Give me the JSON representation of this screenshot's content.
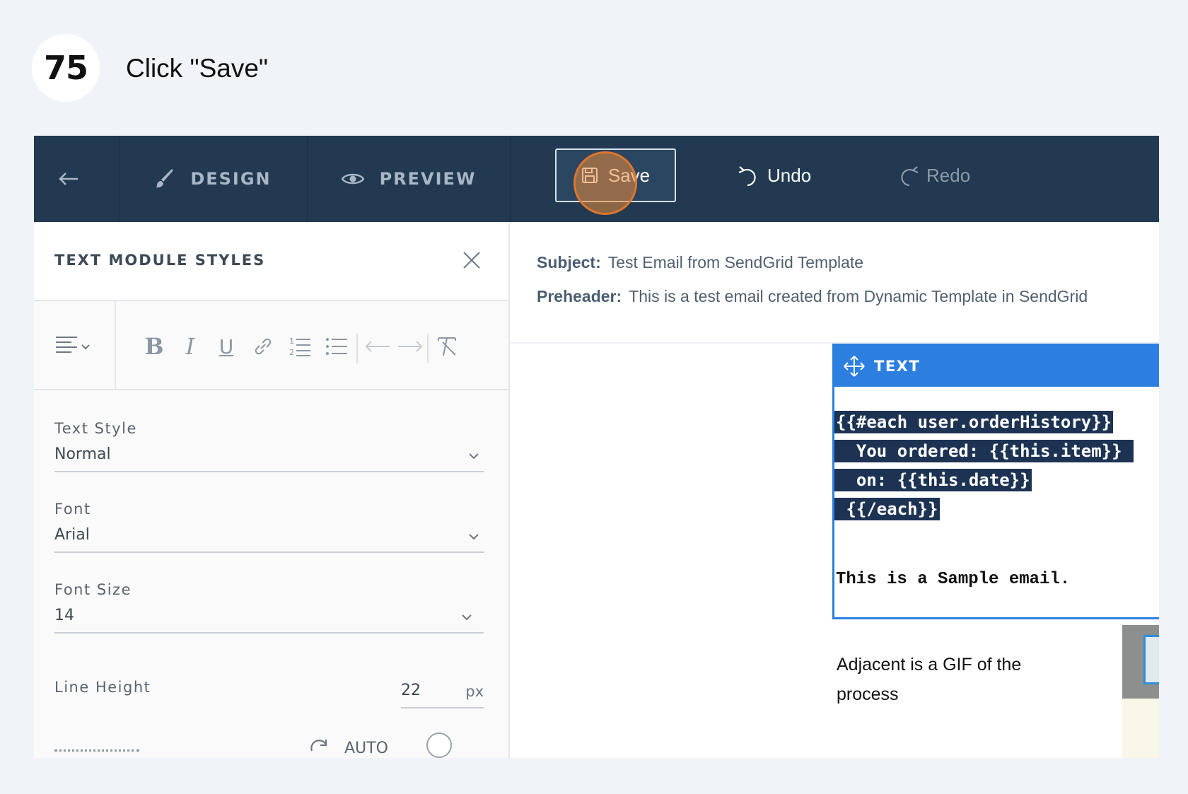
{
  "step": {
    "number": "75",
    "instruction": "Click \"Save\""
  },
  "topbar": {
    "back_icon": "arrow-left-icon",
    "design_label": "DESIGN",
    "preview_label": "PREVIEW",
    "save_label": "Save",
    "undo_label": "Undo",
    "redo_label": "Redo",
    "colors": {
      "bar": "#213a51",
      "highlight_ring": "#e88a3a"
    }
  },
  "left_panel": {
    "title": "TEXT MODULE STYLES",
    "toolbar_icons": [
      "align-left-icon",
      "bold-icon",
      "italic-icon",
      "underline-icon",
      "link-icon",
      "ordered-list-icon",
      "unordered-list-icon",
      "outdent-icon",
      "indent-icon",
      "clear-format-icon"
    ],
    "text_style": {
      "label": "Text Style",
      "value": "Normal"
    },
    "font": {
      "label": "Font",
      "value": "Arial"
    },
    "font_size": {
      "label": "Font Size",
      "value": "14"
    },
    "line_height": {
      "label": "Line Height",
      "value": "22",
      "unit": "px"
    },
    "partial_row": {
      "auto_label": "AUTO"
    }
  },
  "right_panel": {
    "subject_label": "Subject:",
    "subject_value": "Test Email from SendGrid Template",
    "preheader_label": "Preheader:",
    "preheader_value": "This is a test email created from Dynamic Template in SendGrid",
    "module": {
      "header": "TEXT",
      "code_lines": [
        "{{#each user.orderHistory}}",
        "  You ordered: {{this.item}} ",
        "  on: {{this.date}}",
        " {{/each}}"
      ],
      "plain_line": "This is a Sample email.",
      "accent": "#2c7fdf"
    },
    "note_line1": "Adjacent is a GIF of the",
    "note_line2": "process"
  }
}
